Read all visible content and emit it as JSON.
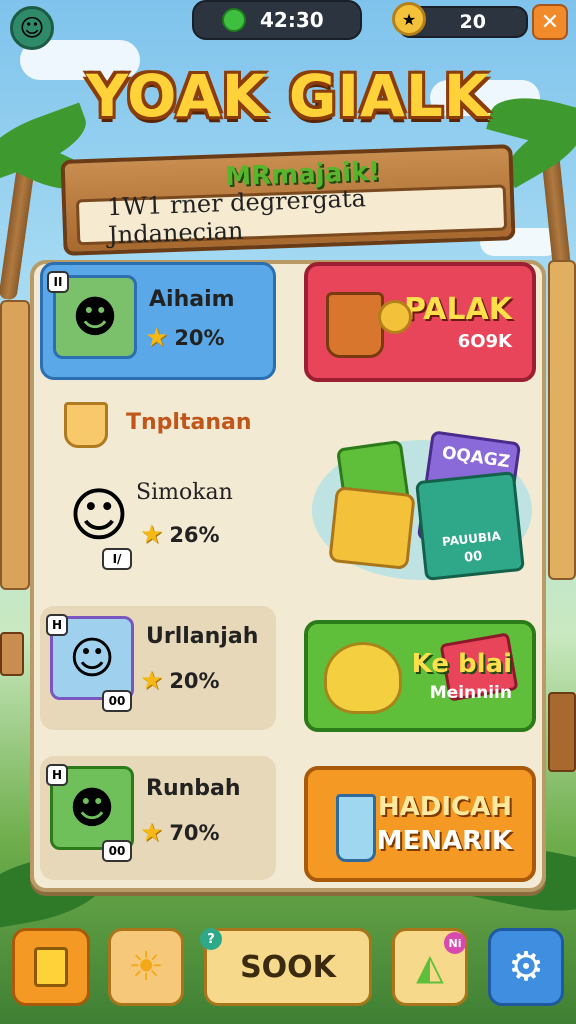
{
  "header": {
    "timer": "42:30",
    "coins": "20",
    "close_label": "✕"
  },
  "title": "YOAK GIALK",
  "banner": {
    "subtitle": "MRmajaik!",
    "text": "1W1 rner degrergata Jndanecian"
  },
  "left_cards": [
    {
      "name": "Aihaim",
      "stat": "20%",
      "badge": "II"
    },
    {
      "name": "Tnpltanan",
      "sub_name": "Simokan",
      "stat": "26%",
      "badge": "I/"
    },
    {
      "name": "Urllanjah",
      "stat": "20%",
      "badge": "00"
    },
    {
      "name": "Runbah",
      "stat": "70%",
      "badge": "00"
    }
  ],
  "right_cards": [
    {
      "line1": "PALAK",
      "line2": "6O9K"
    },
    {
      "line1": "OQAGZ",
      "line2": "PAUUBIA",
      "line3": "00"
    },
    {
      "line1": "Ke blai",
      "line2": "Meinniin"
    },
    {
      "line1": "HADICAH",
      "line2": "MENARIK"
    }
  ],
  "bottom_bar": {
    "sook_label": "SOOK",
    "sook_badge": "?",
    "notif_badge": "Ni"
  },
  "colors": {
    "title": "#ffd23a",
    "red_card": "#e8455a",
    "green_card": "#5fbf3a",
    "orange_card": "#f49a24",
    "blue_card": "#5aa8e8"
  }
}
